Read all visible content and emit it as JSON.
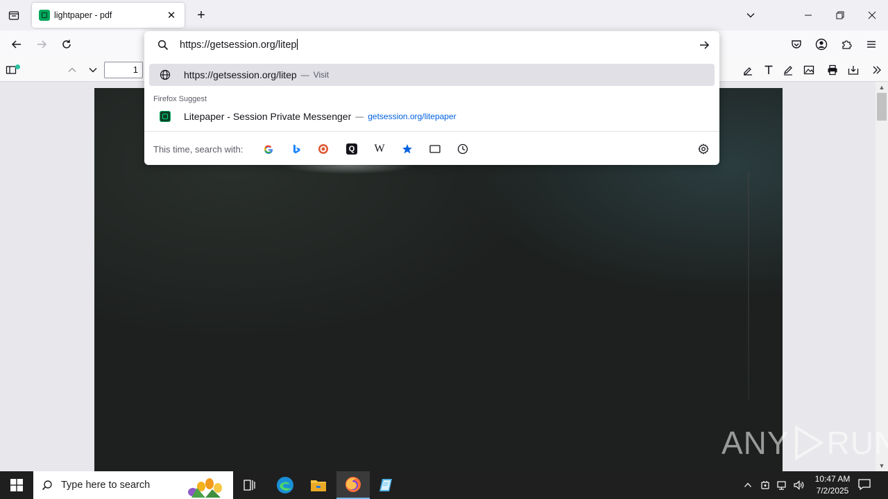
{
  "browser": {
    "tab": {
      "title": "lightpaper - pdf",
      "close_glyph": "✕"
    },
    "new_tab_glyph": "+",
    "window_controls": {
      "minimize": "—",
      "restore": "❐",
      "close": "✕"
    }
  },
  "pdf_toolbar": {
    "page_number": "1"
  },
  "urlbar": {
    "typed_text": "https://getsession.org/litep",
    "results": [
      {
        "icon": "globe-icon",
        "title": "https://getsession.org/litep",
        "separator": "—",
        "action": "Visit"
      }
    ],
    "suggest_group_label": "Firefox Suggest",
    "suggestions": [
      {
        "icon": "session-favicon",
        "title": "Litepaper - Session Private Messenger",
        "separator": "—",
        "url": "getsession.org/litepaper"
      }
    ],
    "one_off_label": "This time, search with:",
    "engines": [
      "google-icon",
      "bing-icon",
      "duckduckgo-icon",
      "qwant-icon",
      "wikipedia-icon",
      "bookmarks-icon",
      "tabs-icon",
      "history-icon"
    ],
    "wikipedia_glyph": "W",
    "qwant_glyph": "Q"
  },
  "watermark": {
    "left": "ANY",
    "right": "RUN"
  },
  "taskbar": {
    "search_placeholder": "Type here to search",
    "time": "10:47 AM",
    "date": "7/2/2025"
  },
  "colors": {
    "accent": "#0061e0",
    "session_green": "#00a65a",
    "taskbar": "#1f1f1f"
  }
}
